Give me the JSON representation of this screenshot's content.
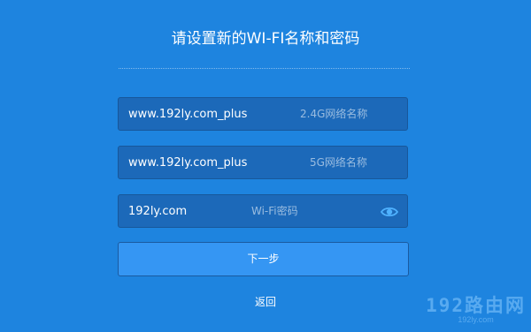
{
  "title": "请设置新的WI-FI名称和密码",
  "fields": [
    {
      "value": "www.192ly.com_plus",
      "hint": "2.4G网络名称"
    },
    {
      "value": "www.192ly.com_plus",
      "hint": "5G网络名称"
    },
    {
      "value": "192ly.com",
      "hint": "Wi-Fi密码",
      "icon": "eye-icon"
    }
  ],
  "buttons": {
    "next_label": "下一步",
    "back_label": "返回"
  },
  "watermark": {
    "main": "192路由网",
    "sub": "192ly.com"
  },
  "colors": {
    "background": "#1e84df",
    "field_background": "#1c69b9",
    "button_background": "#3596f3",
    "icon_accent": "#4fb2ff"
  }
}
